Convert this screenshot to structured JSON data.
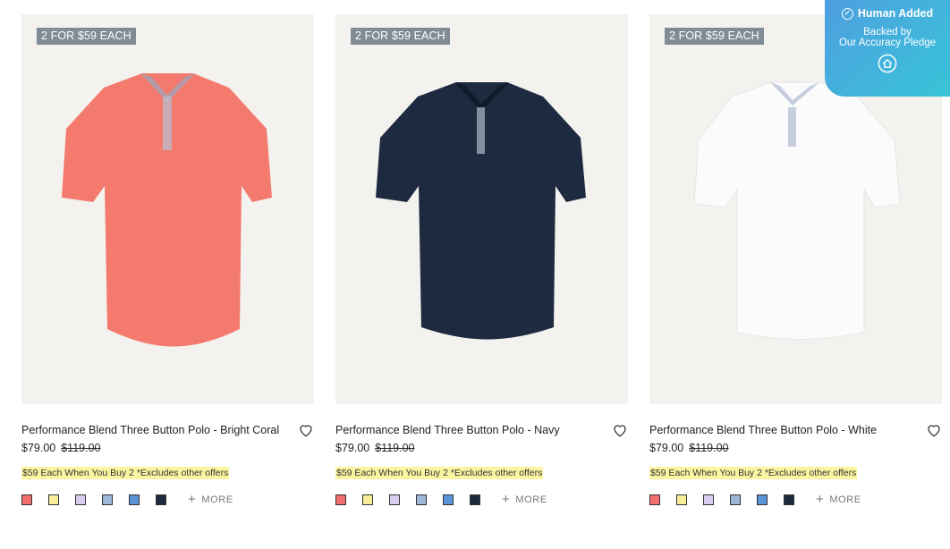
{
  "products": [
    {
      "badge": "2 FOR $59 EACH",
      "title": "Performance Blend Three Button Polo - Bright Coral",
      "price": "$79.00",
      "original_price": "$119.00",
      "offer": "$59 Each When You Buy 2 *Excludes other offers",
      "shirt_color": "#f47a6e",
      "more_label": "MORE"
    },
    {
      "badge": "2 FOR $59 EACH",
      "title": "Performance Blend Three Button Polo - Navy",
      "price": "$79.00",
      "original_price": "$119.00",
      "offer": "$59 Each When You Buy 2 *Excludes other offers",
      "shirt_color": "#1d2a3f",
      "more_label": "MORE"
    },
    {
      "badge": "2 FOR $59 EACH",
      "title": "Performance Blend Three Button Polo - White",
      "price": "$79.00",
      "original_price": "$119.00",
      "offer": "$59 Each When You Buy 2 *Excludes other offers",
      "shirt_color": "#fbfbfb",
      "more_label": "MORE"
    }
  ],
  "swatch_colors": [
    "#f26d6d",
    "#f7ee9a",
    "#d9cdef",
    "#9fb6db",
    "#5a95d8",
    "#1e2a3e"
  ],
  "pledge": {
    "heading": "Human Added",
    "line1": "Backed by",
    "line2": "Our Accuracy Pledge"
  }
}
